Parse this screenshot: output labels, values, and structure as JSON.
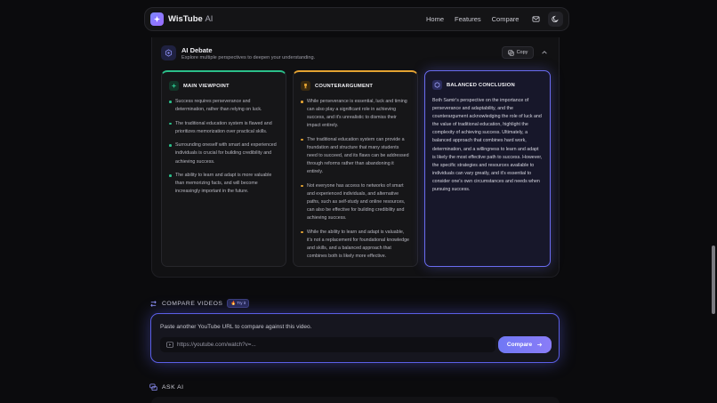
{
  "nav": {
    "brand": "WisTube",
    "brand_suffix": "AI",
    "links": [
      "Home",
      "Features",
      "Compare"
    ],
    "icons": [
      "mail-icon",
      "moon-icon"
    ]
  },
  "debate": {
    "title": "AI Debate",
    "subtitle": "Explore multiple perspectives to deepen your understanding.",
    "copy_label": "Copy",
    "main": {
      "title": "MAIN VIEWPOINT",
      "points": [
        "Success requires perseverance and determination, rather than relying on luck.",
        "The traditional education system is flawed and prioritizes memorization over practical skills.",
        "Surrounding oneself with smart and experienced individuals is crucial for building credibility and achieving success.",
        "The ability to learn and adapt is more valuable than memorizing facts, and will become increasingly important in the future."
      ]
    },
    "counter": {
      "title": "COUNTERARGUMENT",
      "points": [
        "While perseverance is essential, luck and timing can also play a significant role in achieving success, and it's unrealistic to dismiss their impact entirely.",
        "The traditional education system can provide a foundation and structure that many students need to succeed, and its flaws can be addressed through reforms rather than abandoning it entirely.",
        "Not everyone has access to networks of smart and experienced individuals, and alternative paths, such as self-study and online resources, can also be effective for building credibility and achieving success.",
        "While the ability to learn and adapt is valuable, it's not a replacement for foundational knowledge and skills, and a balanced approach that combines both is likely more effective."
      ]
    },
    "conclusion": {
      "title": "BALANCED CONCLUSION",
      "text": "Both Samir's perspective on the importance of perseverance and adaptability, and the counterargument acknowledging the role of luck and the value of traditional education, highlight the complexity of achieving success. Ultimately, a balanced approach that combines hard work, determination, and a willingness to learn and adapt is likely the most effective path to success. However, the specific strategies and resources available to individuals can vary greatly, and it's essential to consider one's own circumstances and needs when pursuing success."
    }
  },
  "compare": {
    "title": "COMPARE VIDEOS",
    "badge": "🔥 Try it",
    "label": "Paste another YouTube URL to compare against this video.",
    "placeholder": "https://youtube.com/watch?v=...",
    "button": "Compare"
  },
  "ask": {
    "title": "ASK AI"
  },
  "colors": {
    "accent": "#6366f1",
    "main": "#2bbf8a",
    "counter": "#e3a232"
  }
}
